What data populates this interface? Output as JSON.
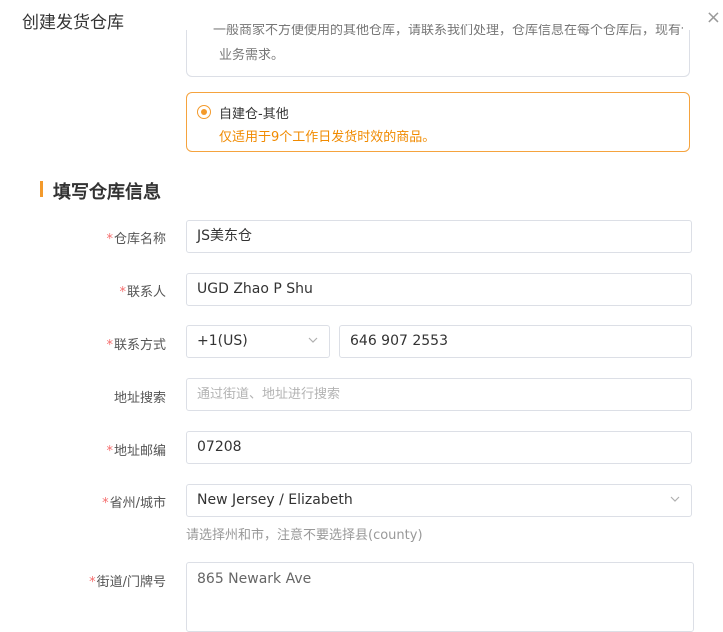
{
  "dialog": {
    "title": "创建发货仓库",
    "close_icon": "×"
  },
  "options": {
    "partial_line1": "一般商家不方便使用的其他仓库，请联系我们处理，仓库信息在每个仓库后，现有仓库不能满足",
    "partial_line2": "业务需求。",
    "selected": {
      "label": "自建仓-其他",
      "description": "仅适用于9个工作日发货时效的商品。"
    }
  },
  "section": {
    "title": "填写仓库信息"
  },
  "form": {
    "required_mark": "*",
    "warehouse_name": {
      "label": "仓库名称",
      "value": "JS美东仓"
    },
    "contact": {
      "label": "联系人",
      "value": "UGD Zhao P Shu"
    },
    "phone": {
      "label": "联系方式",
      "code": "+1(US)",
      "number": "646 907 2553"
    },
    "address_search": {
      "label": "地址搜索",
      "placeholder": "通过街道、地址进行搜索"
    },
    "zip": {
      "label": "地址邮编",
      "value": "07208"
    },
    "state_city": {
      "label": "省州/城市",
      "value": "New Jersey / Elizabeth",
      "hint": "请选择州和市，注意不要选择县(county)"
    },
    "street": {
      "label": "街道/门牌号",
      "value": "865 Newark Ave"
    }
  }
}
